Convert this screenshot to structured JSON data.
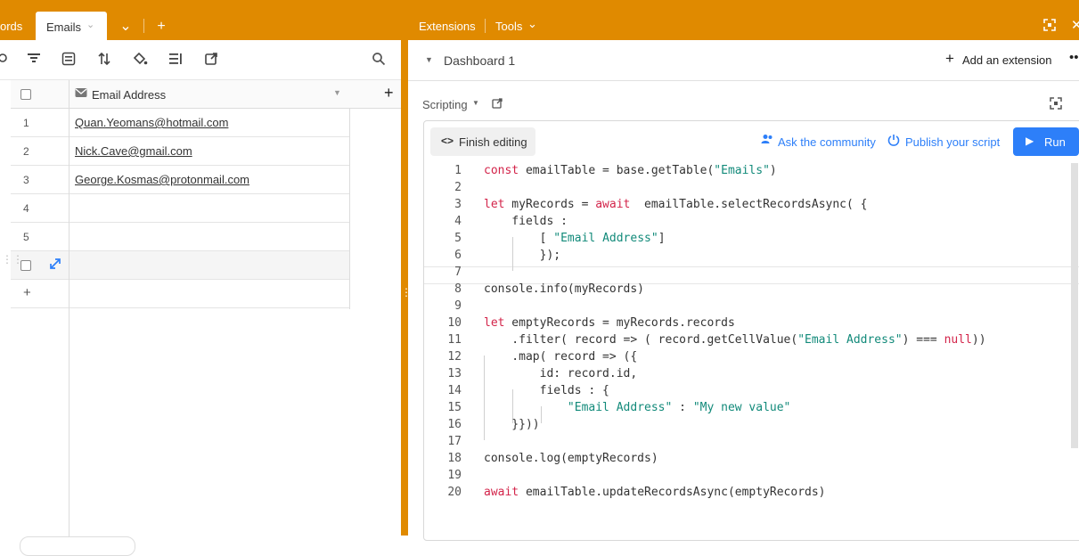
{
  "left_tabs": {
    "prev_tab_partial": "ords",
    "active_tab": "Emails"
  },
  "grid": {
    "column_header": "Email Address",
    "rows": [
      {
        "num": "1",
        "email": "Quan.Yeomans@hotmail.com"
      },
      {
        "num": "2",
        "email": "Nick.Cave@gmail.com"
      },
      {
        "num": "3",
        "email": "George.Kosmas@protonmail.com"
      },
      {
        "num": "4",
        "email": ""
      },
      {
        "num": "5",
        "email": ""
      }
    ],
    "add_row_label": "+"
  },
  "right": {
    "extensions_label": "Extensions",
    "tools_label": "Tools",
    "dashboard_title": "Dashboard 1",
    "add_extension_label": "Add an extension",
    "scripting_label": "Scripting",
    "finish_editing_label": "Finish editing",
    "ask_community_label": "Ask the community",
    "publish_label": "Publish your script",
    "run_label": "Run"
  },
  "colors": {
    "accent_orange": "#e08a00",
    "run_blue": "#2d7ff9",
    "keyword": "#d3244a",
    "string": "#128a7a"
  },
  "code_lines": [
    "const emailTable = base.getTable(\"Emails\")",
    "",
    "let myRecords = await  emailTable.selectRecordsAsync( {",
    "    fields :",
    "        [ \"Email Address\"]",
    "        });",
    "",
    "console.info(myRecords)",
    "",
    "let emptyRecords = myRecords.records",
    "    .filter( record => ( record.getCellValue(\"Email Address\") === null))",
    "    .map( record => ({",
    "        id: record.id,",
    "        fields : {",
    "            \"Email Address\" : \"My new value\"",
    "    }}))",
    "",
    "console.log(emptyRecords)",
    "",
    "await emailTable.updateRecordsAsync(emptyRecords)"
  ]
}
